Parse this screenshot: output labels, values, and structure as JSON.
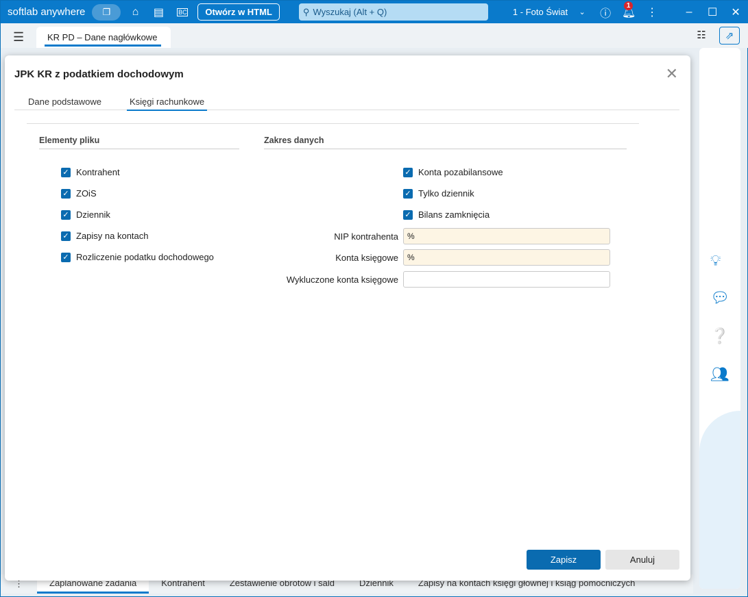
{
  "topbar": {
    "brand": "softlab anywhere",
    "open_html": "Otwórz w HTML",
    "search_placeholder": "Wyszukaj (Alt + Q)",
    "company": "1 - Foto Świat",
    "notifications": "1"
  },
  "doc_tab": "KR PD – Dane nagłówkowe",
  "dialog": {
    "title": "JPK KR z podatkiem dochodowym",
    "tabs": [
      {
        "label": "Dane podstawowe",
        "active": false
      },
      {
        "label": "Księgi rachunkowe",
        "active": true
      }
    ],
    "left_section": "Elementy pliku",
    "right_section": "Zakres danych",
    "left_checks": [
      {
        "label": "Kontrahent",
        "checked": true
      },
      {
        "label": "ZOiS",
        "checked": true
      },
      {
        "label": "Dziennik",
        "checked": true
      },
      {
        "label": "Zapisy na kontach",
        "checked": true
      },
      {
        "label": "Rozliczenie podatku dochodowego",
        "checked": true
      }
    ],
    "right_checks": [
      {
        "label": "Konta pozabilansowe",
        "checked": true
      },
      {
        "label": "Tylko dziennik",
        "checked": true
      },
      {
        "label": "Bilans zamknięcia",
        "checked": true
      }
    ],
    "fields": [
      {
        "label": "NIP kontrahenta",
        "value": "%"
      },
      {
        "label": "Konta księgowe",
        "value": "%"
      },
      {
        "label": "Wykluczone konta księgowe",
        "value": ""
      }
    ],
    "save": "Zapisz",
    "cancel": "Anuluj"
  },
  "bottom_tabs": [
    "Zaplanowane zadania",
    "Kontrahent",
    "Zestawienie obrotów i sald",
    "Dziennik",
    "Zapisy na kontach księgi głównej i ksiąg pomocniczych"
  ],
  "colors": {
    "accent": "#0a7acb",
    "button": "#0a6bb0",
    "required_field": "#fdf5e4"
  }
}
